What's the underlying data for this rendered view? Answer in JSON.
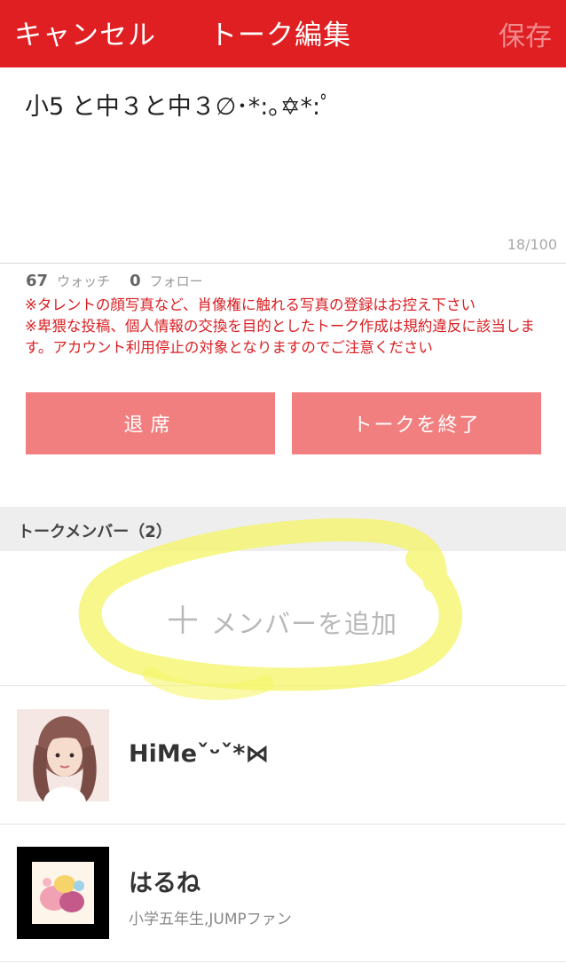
{
  "header": {
    "cancel_label": "キャンセル",
    "title": "トーク編集",
    "save_label": "保存"
  },
  "talk": {
    "name": "小5 と中３と中３∅･*:｡✡*:ﾟ",
    "char_count": "18/100"
  },
  "stats": {
    "watch_count": "67",
    "watch_label": "ウォッチ",
    "follow_count": "0",
    "follow_label": "フォロー"
  },
  "notices": [
    "※タレントの顔写真など、肖像権に触れる写真の登録はお控え下さい",
    "※卑猥な投稿、個人情報の交換を目的としたトーク作成は規約違反に該当します。アカウント利用停止の対象となりますのでご注意ください"
  ],
  "buttons": {
    "leave": "退席",
    "end_talk": "トークを終了"
  },
  "members_section": {
    "header": "トークメンバー（2）",
    "add_label": "メンバーを追加"
  },
  "members": [
    {
      "name": "HiMeˇᵕˇ*⋈",
      "bio": ""
    },
    {
      "name": "はるね",
      "bio": "小学五年生,JUMPファン"
    }
  ],
  "colors": {
    "header_bg": "#df1f22",
    "button_bg": "#f27f7f",
    "notice_text": "#d91e22",
    "highlight": "#f5f56a"
  }
}
